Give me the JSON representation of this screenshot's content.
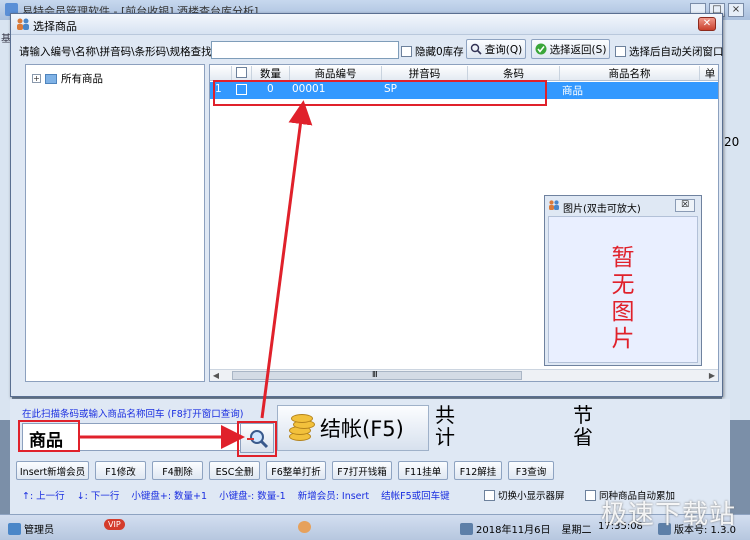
{
  "background_app": {
    "title": "易特会员管理软件 - [前台收银] 酒楼查台库分析]",
    "right_edge_value": "20",
    "left_tab_fragment": "基"
  },
  "dialog": {
    "title": "选择商品",
    "search_label": "请输入编号\\名称\\拼音码\\条形码\\规格查找:",
    "search_value": "",
    "hide_zero_stock_label": "隐藏0库存",
    "query_button": "查询(Q)",
    "select_return_button": "选择返回(S)",
    "auto_close_label": "选择后自动关闭窗口",
    "tree": {
      "root_label": "所有商品"
    },
    "grid": {
      "columns": [
        "数量",
        "商品编号",
        "拼音码",
        "条码",
        "商品名称",
        "单"
      ],
      "rows": [
        {
          "index": "1",
          "qty": "0",
          "code": "00001",
          "pinyin": "SP",
          "barcode": "",
          "name": "商品"
        }
      ],
      "scroll_center": "Ⅲ"
    }
  },
  "image_window": {
    "title": "图片(双击可放大)",
    "close": "☒",
    "placeholder": "暂无图片"
  },
  "pos": {
    "hint": "在此扫描条码或输入商品名称回车 (F8打开窗口查询)",
    "input_value": "商品",
    "checkout_label": "结帐(F5)",
    "total_label": "共计",
    "saved_label": "节省",
    "fkeys": [
      "Insert新增会员",
      "F1修改",
      "F4删除",
      "ESC全删",
      "F6整单打折",
      "F7打开钱箱",
      "F11挂单",
      "F12解挂",
      "F3查询"
    ],
    "shortcuts": [
      "↑: 上一行",
      "↓: 下一行",
      "小键盘+: 数量+1",
      "小键盘-: 数量-1",
      "新增会员: Insert",
      "结帐F5或回车键"
    ],
    "toggle_display_label": "切换小显示器屏",
    "merge_label": "同种商品自动累加"
  },
  "statusbar": {
    "user": "管理员",
    "vip_badge": "VIP",
    "date": "2018年11月6日",
    "weekday": "星期二",
    "time": "17:35:08",
    "version": "版本号: 1.3.0"
  },
  "watermark": "极速下载站",
  "colors": {
    "selection": "#3399ff",
    "annotation": "#e0212b",
    "hint_text": "#1a2ee0"
  }
}
